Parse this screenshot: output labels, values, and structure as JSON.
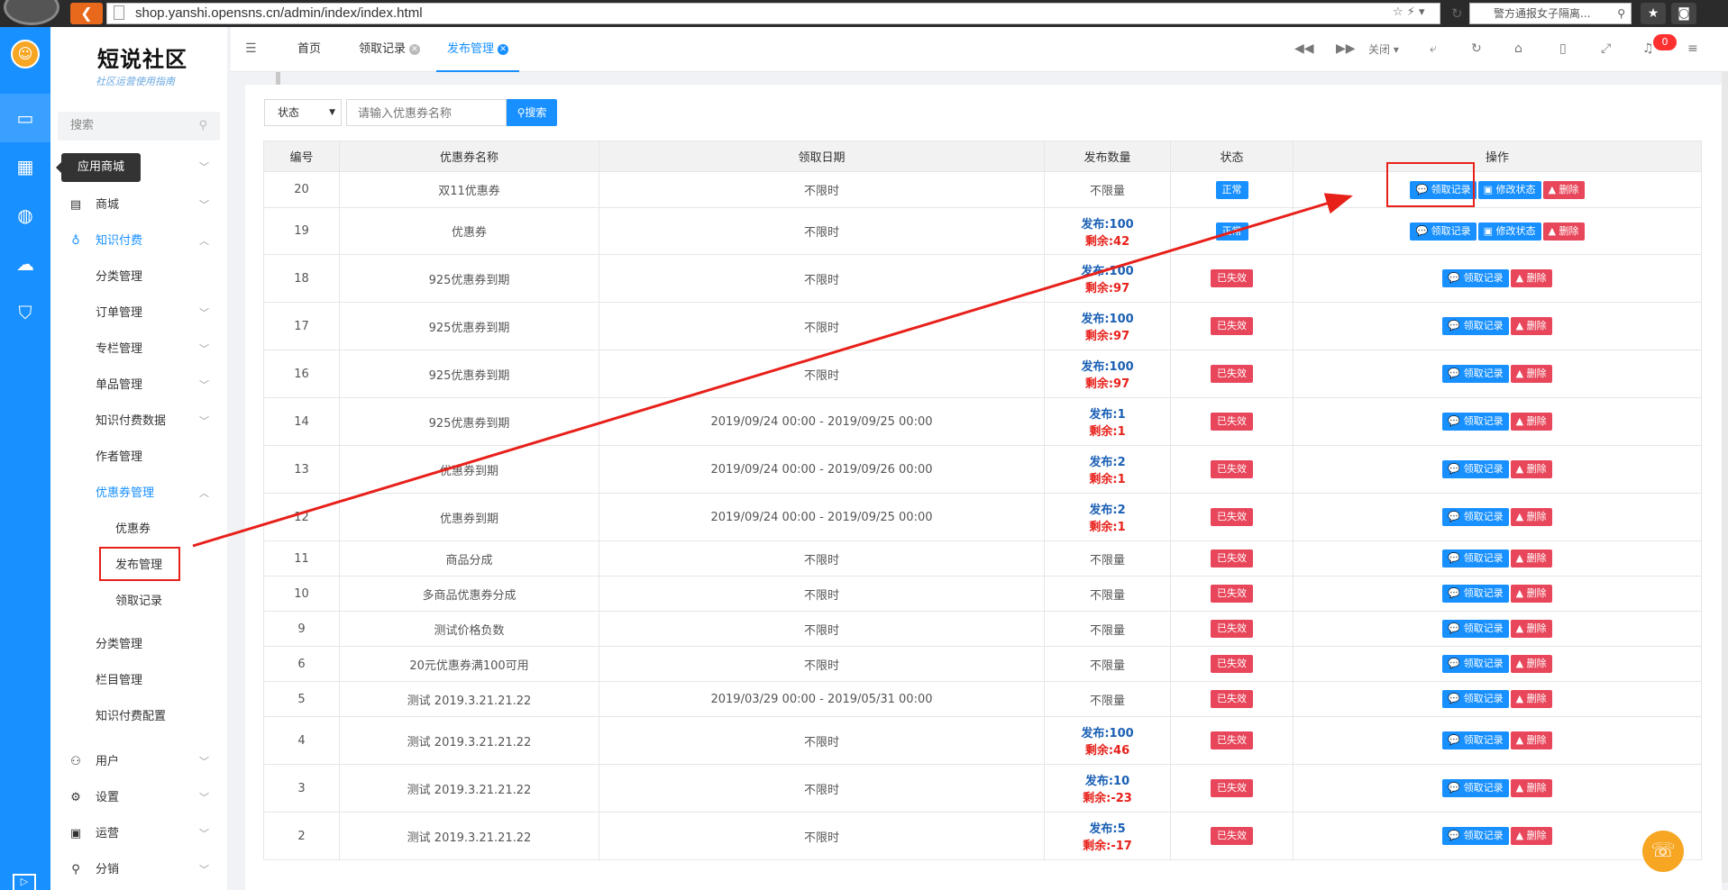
{
  "browser": {
    "url": "shop.yanshi.opensns.cn/admin/index/index.html",
    "search_text": "警方通报女子隔离..."
  },
  "sidebar": {
    "logo": "短说社区",
    "logo_sub": "社区运营使用指南",
    "search_placeholder": "搜索",
    "tooltip": "应用商城",
    "items": [
      {
        "label": "商城",
        "icon": "store-icon"
      },
      {
        "label": "知识付费",
        "icon": "bulb-icon"
      },
      {
        "label": "分类管理"
      },
      {
        "label": "订单管理"
      },
      {
        "label": "专栏管理"
      },
      {
        "label": "单品管理"
      },
      {
        "label": "知识付费数据"
      },
      {
        "label": "作者管理"
      },
      {
        "label": "优惠券管理"
      },
      {
        "label": "优惠券"
      },
      {
        "label": "发布管理"
      },
      {
        "label": "领取记录"
      },
      {
        "label": "分类管理"
      },
      {
        "label": "栏目管理"
      },
      {
        "label": "知识付费配置"
      },
      {
        "label": "用户",
        "icon": "user-icon"
      },
      {
        "label": "设置",
        "icon": "gear-icon"
      },
      {
        "label": "运营",
        "icon": "monitor-icon"
      },
      {
        "label": "分销",
        "icon": "tree-icon"
      }
    ]
  },
  "topnav": {
    "tabs": [
      {
        "label": "首页"
      },
      {
        "label": "领取记录"
      },
      {
        "label": "发布管理"
      }
    ],
    "close_label": "关闭",
    "notification_count": "0"
  },
  "filter": {
    "status_label": "状态",
    "input_placeholder": "请输入优惠券名称",
    "search_label": "搜索"
  },
  "table": {
    "headers": [
      "编号",
      "优惠券名称",
      "领取日期",
      "发布数量",
      "状态",
      "操作"
    ],
    "buttons": {
      "record": "领取记录",
      "modify": "修改状态",
      "delete": "删除"
    },
    "rows": [
      {
        "id": "20",
        "name": "双11优惠券",
        "date": "不限时",
        "qty1": "不限量",
        "qty2": "",
        "status": "正常",
        "ok": true,
        "modify": true
      },
      {
        "id": "19",
        "name": "优惠券",
        "date": "不限时",
        "qty1": "发布:100",
        "qty2": "剩余:42",
        "status": "正常",
        "ok": true,
        "modify": true
      },
      {
        "id": "18",
        "name": "925优惠券到期",
        "date": "不限时",
        "qty1": "发布:100",
        "qty2": "剩余:97",
        "status": "已失效",
        "ok": false,
        "modify": false
      },
      {
        "id": "17",
        "name": "925优惠券到期",
        "date": "不限时",
        "qty1": "发布:100",
        "qty2": "剩余:97",
        "status": "已失效",
        "ok": false,
        "modify": false
      },
      {
        "id": "16",
        "name": "925优惠券到期",
        "date": "不限时",
        "qty1": "发布:100",
        "qty2": "剩余:97",
        "status": "已失效",
        "ok": false,
        "modify": false
      },
      {
        "id": "14",
        "name": "925优惠券到期",
        "date": "2019/09/24 00:00 - 2019/09/25 00:00",
        "qty1": "发布:1",
        "qty2": "剩余:1",
        "status": "已失效",
        "ok": false,
        "modify": false
      },
      {
        "id": "13",
        "name": "优惠券到期",
        "date": "2019/09/24 00:00 - 2019/09/26 00:00",
        "qty1": "发布:2",
        "qty2": "剩余:1",
        "status": "已失效",
        "ok": false,
        "modify": false
      },
      {
        "id": "12",
        "name": "优惠券到期",
        "date": "2019/09/24 00:00 - 2019/09/25 00:00",
        "qty1": "发布:2",
        "qty2": "剩余:1",
        "status": "已失效",
        "ok": false,
        "modify": false
      },
      {
        "id": "11",
        "name": "商品分成",
        "date": "不限时",
        "qty1": "不限量",
        "qty2": "",
        "status": "已失效",
        "ok": false,
        "modify": false
      },
      {
        "id": "10",
        "name": "多商品优惠券分成",
        "date": "不限时",
        "qty1": "不限量",
        "qty2": "",
        "status": "已失效",
        "ok": false,
        "modify": false
      },
      {
        "id": "9",
        "name": "测试价格负数",
        "date": "不限时",
        "qty1": "不限量",
        "qty2": "",
        "status": "已失效",
        "ok": false,
        "modify": false
      },
      {
        "id": "6",
        "name": "20元优惠券满100可用",
        "date": "不限时",
        "qty1": "不限量",
        "qty2": "",
        "status": "已失效",
        "ok": false,
        "modify": false
      },
      {
        "id": "5",
        "name": "测试 2019.3.21.21.22",
        "date": "2019/03/29 00:00 - 2019/05/31 00:00",
        "qty1": "不限量",
        "qty2": "",
        "status": "已失效",
        "ok": false,
        "modify": false
      },
      {
        "id": "4",
        "name": "测试 2019.3.21.21.22",
        "date": "不限时",
        "qty1": "发布:100",
        "qty2": "剩余:46",
        "status": "已失效",
        "ok": false,
        "modify": false
      },
      {
        "id": "3",
        "name": "测试 2019.3.21.21.22",
        "date": "不限时",
        "qty1": "发布:10",
        "qty2": "剩余:-23",
        "status": "已失效",
        "ok": false,
        "modify": false
      },
      {
        "id": "2",
        "name": "测试 2019.3.21.21.22",
        "date": "不限时",
        "qty1": "发布:5",
        "qty2": "剩余:-17",
        "status": "已失效",
        "ok": false,
        "modify": false
      }
    ]
  },
  "colors": {
    "primary": "#1890ff",
    "danger": "#e8465a",
    "annotation": "#e8201a"
  }
}
